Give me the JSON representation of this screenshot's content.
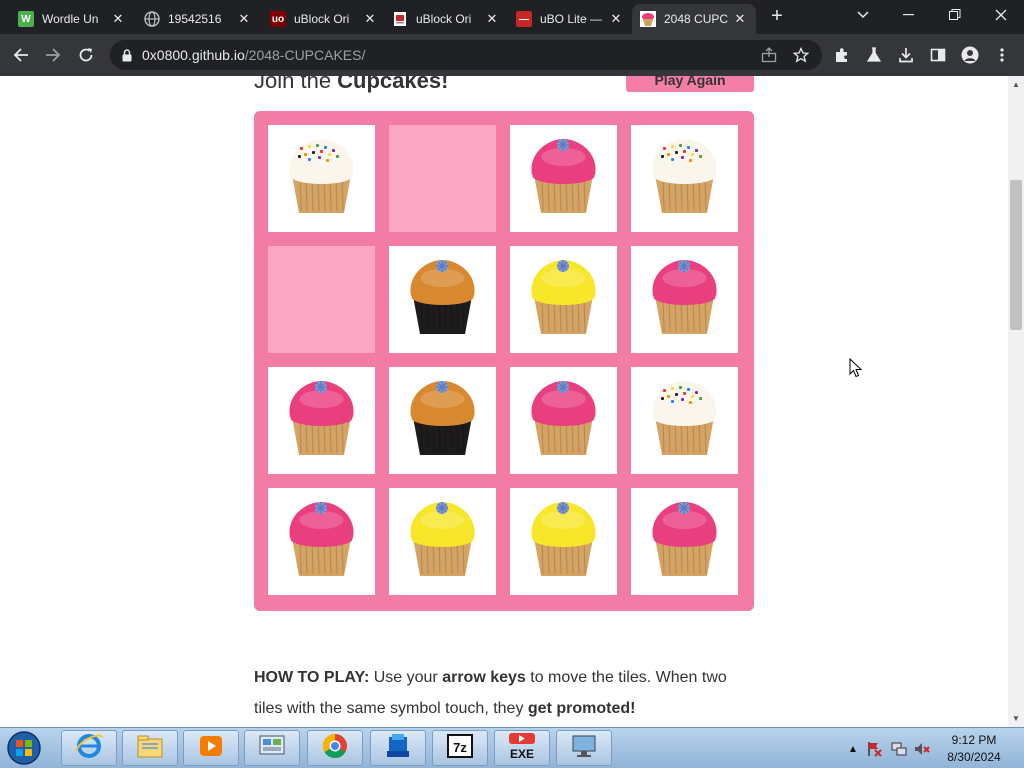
{
  "browser": {
    "tabs": [
      {
        "title": "Wordle Un",
        "favicon": "wordle-w-icon",
        "favicon_color": "#4caf50",
        "favicon_text": "W"
      },
      {
        "title": "19542516",
        "favicon": "globe-icon",
        "favicon_color": "#9aa0a6",
        "favicon_text": ""
      },
      {
        "title": "uBlock Ori",
        "favicon": "ublock-icon",
        "favicon_color": "#800000",
        "favicon_text": "uo"
      },
      {
        "title": "uBlock Ori",
        "favicon": "document-icon",
        "favicon_color": "#ffffff",
        "favicon_text": ""
      },
      {
        "title": "uBO Lite —",
        "favicon": "ubo-lite-icon",
        "favicon_color": "#c62828",
        "favicon_text": "—"
      },
      {
        "title": "2048 CUPC",
        "favicon": "cupcake-favicon",
        "favicon_color": "#f8bbd0",
        "favicon_text": ""
      }
    ],
    "active_tab_index": 5,
    "url_host": "0x0800.github.io",
    "url_path": "/2048-CUPCAKES/"
  },
  "page": {
    "heading_prefix": "Join the ",
    "heading_bold": "Cupcakes!",
    "play_again_label": "Play Again",
    "board": [
      [
        "sprinkle-cupcake",
        "",
        "pink-cupcake",
        "sprinkle-cupcake"
      ],
      [
        "",
        "caramel-cupcake",
        "yellow-cupcake",
        "pink-cupcake"
      ],
      [
        "pink-cupcake",
        "caramel-cupcake",
        "pink-cupcake",
        "sprinkle-cupcake"
      ],
      [
        "pink-cupcake",
        "yellow-cupcake",
        "yellow-cupcake",
        "pink-cupcake"
      ]
    ],
    "howto": {
      "label": "HOW TO PLAY:",
      "part1": " Use your ",
      "bold1": "arrow keys",
      "part2": " to move the tiles. When two tiles with the same symbol touch, they ",
      "bold2": "get promoted!"
    }
  },
  "taskbar": {
    "items": [
      "internet-explorer-icon",
      "file-explorer-icon",
      "media-player-icon",
      "control-panel-icon",
      "chrome-icon",
      "app-installer-icon",
      "7zip-icon",
      "youtube-exe-icon",
      "remote-desktop-icon"
    ],
    "youtube_label": "EXE",
    "sevenzip_label": "7z",
    "clock_time": "9:12 PM",
    "clock_date": "8/30/2024"
  },
  "colors": {
    "board": "#f27ca6",
    "empty_cell": "#fba7c4",
    "accent": "#f57ea7"
  }
}
